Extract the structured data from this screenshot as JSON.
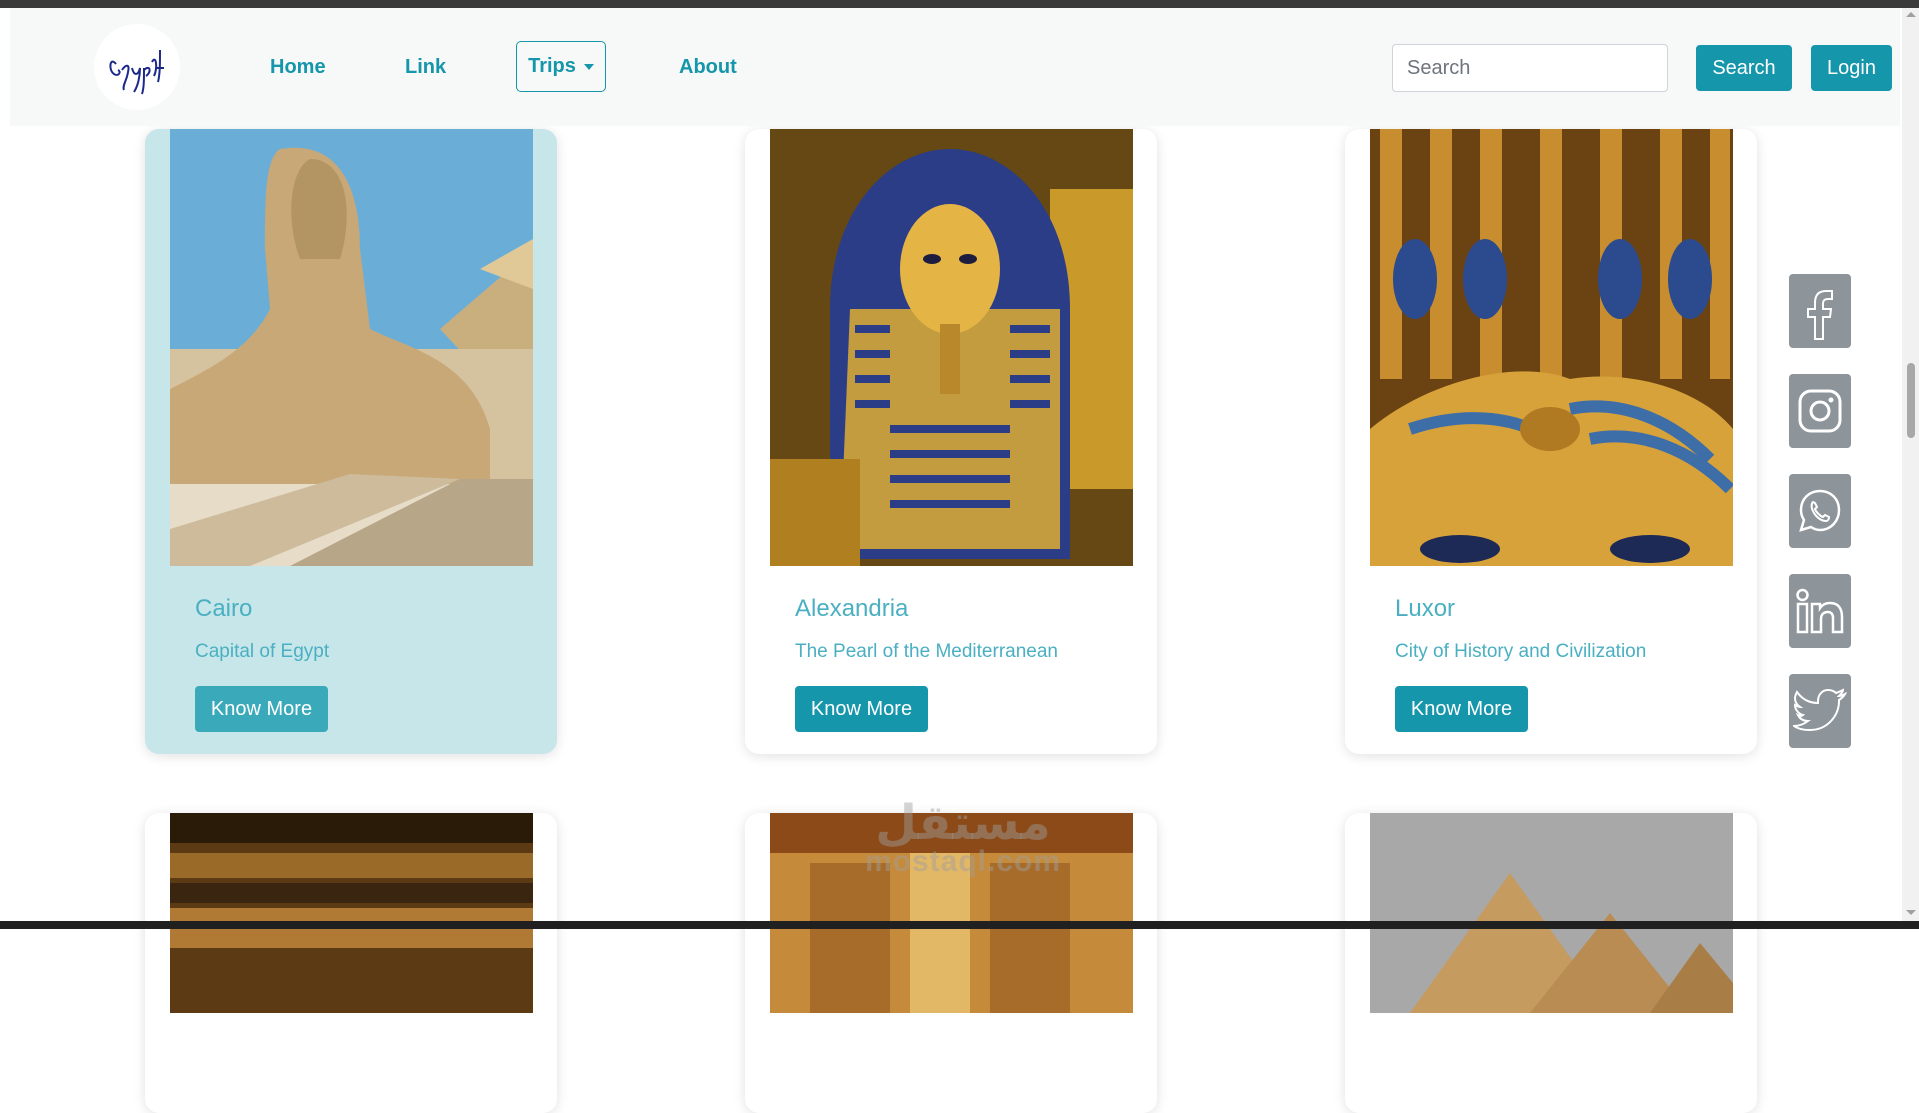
{
  "navbar": {
    "brand": "Egypt",
    "links": [
      {
        "label": "Home"
      },
      {
        "label": "Link"
      },
      {
        "label": "Trips"
      },
      {
        "label": "About"
      }
    ],
    "search": {
      "placeholder": "Search",
      "value": ""
    },
    "search_button": "Search",
    "login_button": "Login"
  },
  "cards": [
    {
      "title": "Cairo",
      "subtitle": "Capital of Egypt",
      "button": "Know More",
      "image": "sphinx-image"
    },
    {
      "title": "Alexandria",
      "subtitle": "The Pearl of the Mediterranean",
      "button": "Know More",
      "image": "pharaoh-mask-image"
    },
    {
      "title": "Luxor",
      "subtitle": "City of History and Civilization",
      "button": "Know More",
      "image": "golden-mask-image"
    }
  ],
  "social": [
    "facebook-icon",
    "instagram-icon",
    "whatsapp-icon",
    "linkedin-icon",
    "twitter-icon"
  ],
  "watermark": {
    "main": "مستقل",
    "sub": "mostaql.com"
  },
  "colors": {
    "accent": "#1596ab",
    "text_accent": "#4ab0c1",
    "card_hover": "#c6e6ea",
    "social_bg": "#8d949a"
  }
}
